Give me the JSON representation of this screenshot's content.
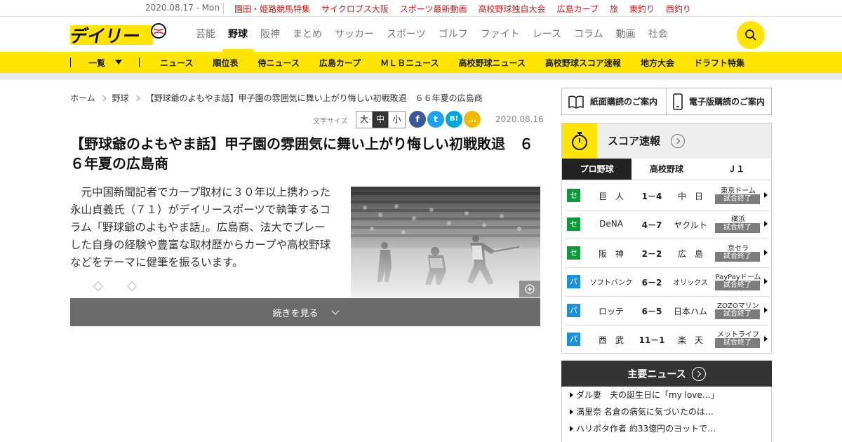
{
  "topbar": {
    "date": "2020.08.17 - Mon",
    "links": [
      "園田・姫路競馬特集",
      "サイクロプス大阪",
      "スポーツ最新動画",
      "高校野球独自大会",
      "広島カープ",
      "旅",
      "東釣り",
      "西釣り"
    ]
  },
  "header": {
    "logo_text": "デイリー",
    "nav": [
      "芸能",
      "野球",
      "阪神",
      "まとめ",
      "サッカー",
      "スポーツ",
      "ゴルフ",
      "ファイト",
      "レース",
      "コラム",
      "動画",
      "社会"
    ],
    "active_nav": "野球"
  },
  "subnav": {
    "ichiran": "一覧",
    "items": [
      "ニュース",
      "順位表",
      "侍ニュース",
      "広島カープ",
      "ＭＬＢニュース",
      "高校野球ニュース",
      "高校野球スコア速報",
      "地方大会",
      "ドラフト特集"
    ]
  },
  "breadcrumb": [
    "ホーム",
    "野球",
    "【野球爺のよもやま話】甲子園の雰囲気に舞い上がり悔しい初戦敗退　６６年夏の広島商"
  ],
  "article": {
    "font_size_label": "文字サイズ",
    "font_sizes": [
      "大",
      "中",
      "小"
    ],
    "share": [
      "f",
      "t",
      "B!",
      "…"
    ],
    "date": "2020.08.16",
    "headline": "【野球爺のよもやま話】甲子園の雰囲気に舞い上がり悔しい初戦敗退　６６年夏の広島商",
    "lead": "元中国新聞記者でカープ取材に３０年以上携わった永山貞義氏（７１）がデイリースポーツで執筆するコラム「野球爺のよもやま話」。広島商、法大でプレーした自身の経験や豊富な取材歴からカープや高校野球などをテーマに健筆を振るいます。",
    "more_label": "続きを見る"
  },
  "subscribe": {
    "paper": "紙面購読のご案内",
    "digital": "電子版購読のご案内"
  },
  "score": {
    "title": "スコア速報",
    "tabs": [
      "プロ野球",
      "高校野球",
      "Ｊ１"
    ],
    "games": [
      {
        "league": "セ",
        "home": "巨　人",
        "score": "1－4",
        "away": "中　日",
        "venue": "東京ドーム",
        "status": "試合終了"
      },
      {
        "league": "セ",
        "home": "DeNA",
        "score": "4－7",
        "away": "ヤクルト",
        "venue": "横浜",
        "status": "試合終了"
      },
      {
        "league": "セ",
        "home": "阪　神",
        "score": "2－2",
        "away": "広　島",
        "venue": "京セラ",
        "status": "試合終了"
      },
      {
        "league": "パ",
        "home": "ソフトバンク",
        "score": "6－2",
        "away": "オリックス",
        "venue": "PayPayドーム",
        "status": "試合終了"
      },
      {
        "league": "パ",
        "home": "ロッテ",
        "score": "6－5",
        "away": "日本ハム",
        "venue": "ZOZOマリン",
        "status": "試合終了"
      },
      {
        "league": "パ",
        "home": "西　武",
        "score": "11－1",
        "away": "楽　天",
        "venue": "メットライフ",
        "status": "試合終了"
      }
    ],
    "colors": {
      "se": "#0c9a3a",
      "pa": "#1e90d6"
    }
  },
  "news": {
    "title": "主要ニュース",
    "items": [
      "ダル妻　夫の誕生日に「my love…」",
      "満里奈 名倉の病気に気づいたのは…",
      "ハリポタ作者 約33億円のヨットで…"
    ]
  }
}
